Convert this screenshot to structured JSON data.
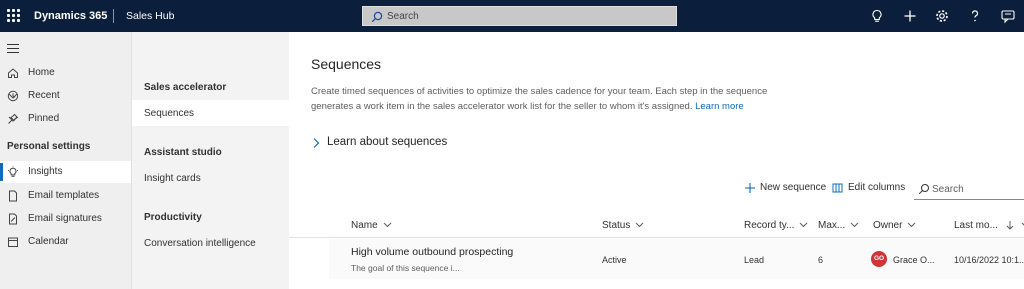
{
  "topbar": {
    "brand": "Dynamics 365",
    "app_name": "Sales Hub",
    "search_placeholder": "Search",
    "icons": [
      "lightbulb-icon",
      "plus-icon",
      "gear-icon",
      "help-icon",
      "chat-icon"
    ]
  },
  "leftnav": {
    "items": [
      {
        "label": "Home",
        "icon": "home-icon"
      },
      {
        "label": "Recent",
        "icon": "clock-icon"
      },
      {
        "label": "Pinned",
        "icon": "pin-icon"
      }
    ],
    "section_title": "Personal settings",
    "settings_items": [
      {
        "label": "Insights",
        "icon": "lightbulb-icon"
      },
      {
        "label": "Email templates",
        "icon": "document-icon"
      },
      {
        "label": "Email signatures",
        "icon": "signature-icon"
      },
      {
        "label": "Calendar",
        "icon": "calendar-icon"
      }
    ]
  },
  "subnav": {
    "groups": [
      {
        "title": "Sales accelerator",
        "items": [
          "Sequences"
        ]
      },
      {
        "title": "Assistant studio",
        "items": [
          "Insight cards"
        ]
      },
      {
        "title": "Productivity",
        "items": [
          "Conversation intelligence"
        ]
      }
    ]
  },
  "main": {
    "title": "Sequences",
    "description": "Create timed sequences of activities to optimize the sales cadence for your team. Each step in the sequence generates a work item in the sales accelerator work list for the seller to whom it's assigned.",
    "learn_more_link": "Learn more",
    "learn_about": "Learn about sequences",
    "commands": {
      "new_sequence": "New sequence",
      "edit_columns": "Edit columns",
      "search_placeholder": "Search"
    },
    "columns": [
      "Name",
      "Status",
      "Record ty...",
      "Max...",
      "Owner",
      "Last mo..."
    ],
    "rows": [
      {
        "name": "High volume outbound prospecting",
        "description": "The goal of this sequence i...",
        "status": "Active",
        "record_type": "Lead",
        "max": "6",
        "owner_initials": "GO",
        "owner": "Grace O...",
        "last_modified": "10/16/2022 10:1..."
      }
    ]
  },
  "colors": {
    "topbar": "#0b1e3c",
    "accent": "#0f6cbd",
    "avatar": "#d13438"
  }
}
